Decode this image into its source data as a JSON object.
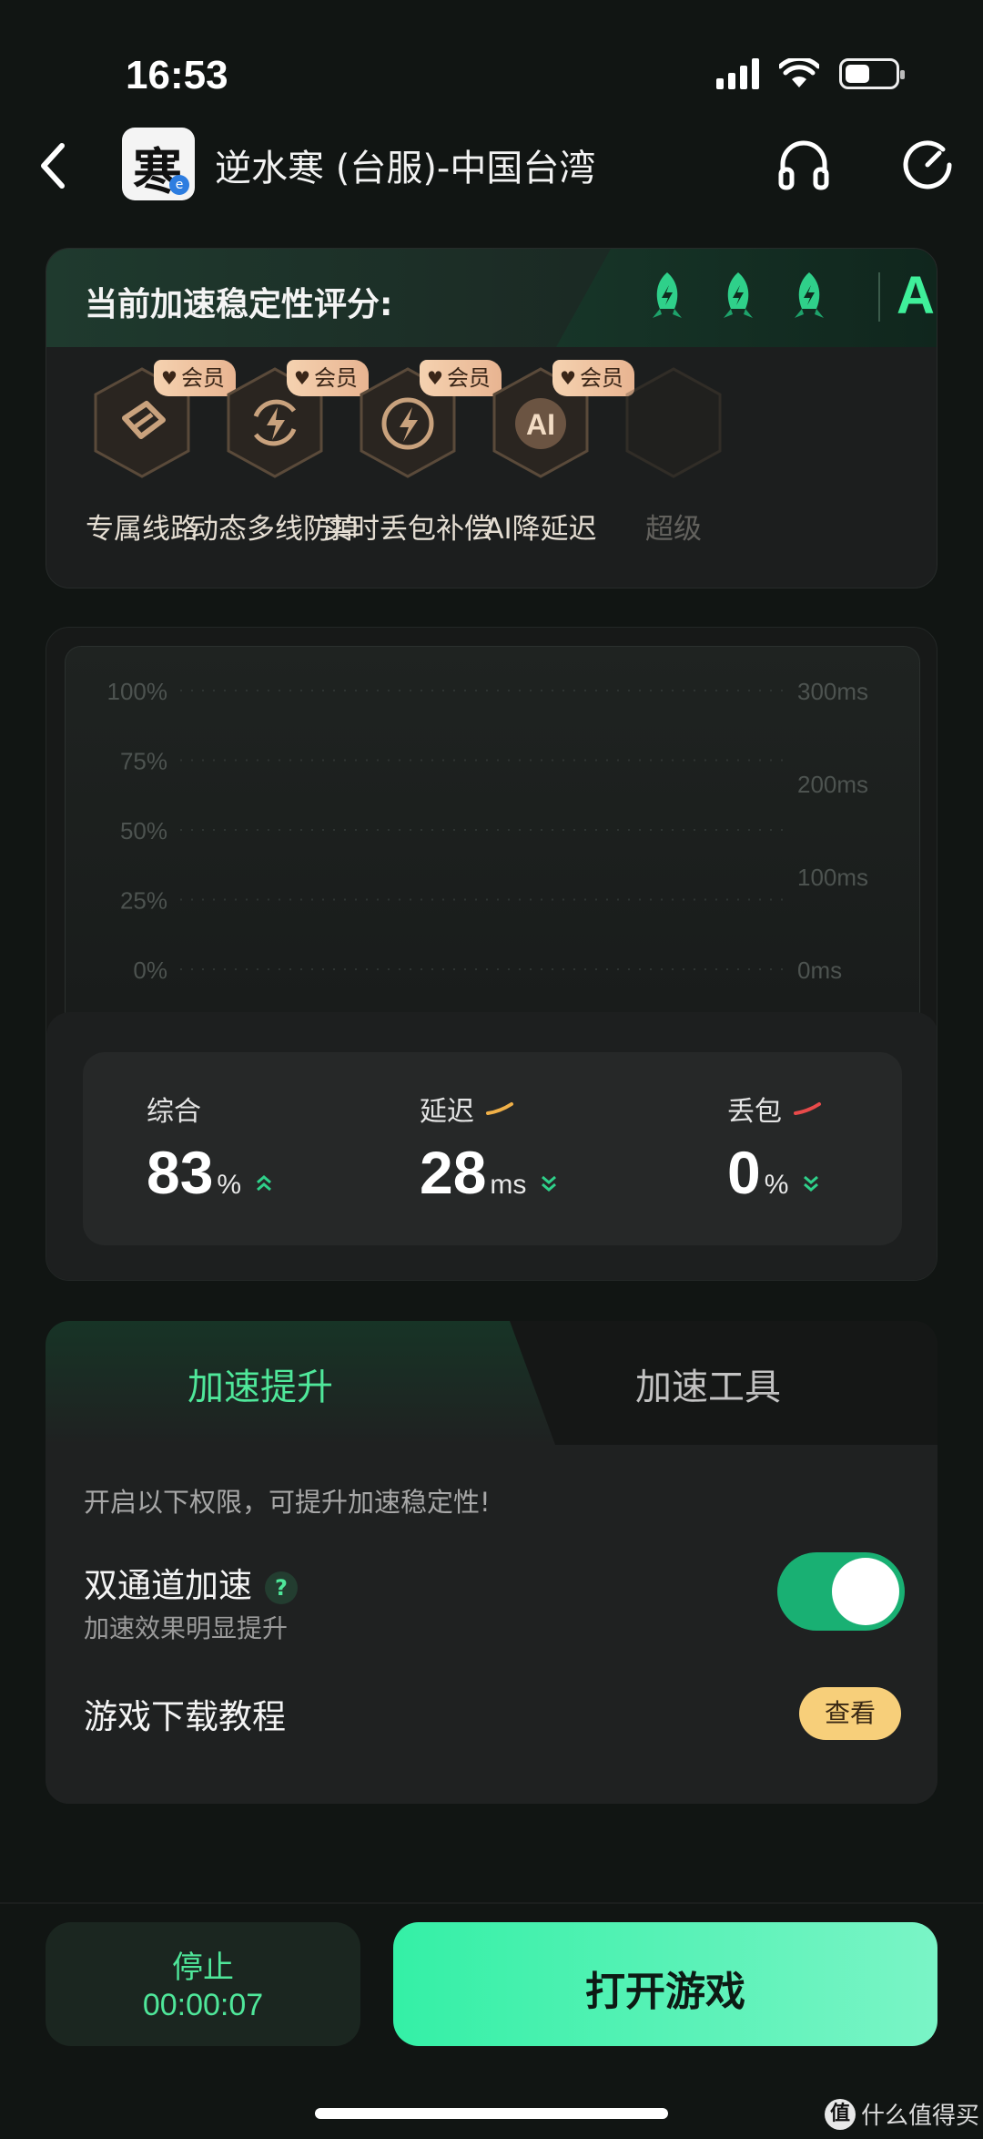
{
  "status_bar": {
    "time": "16:53"
  },
  "header": {
    "game_title": "逆水寒 (台服)-中国台湾",
    "game_icon_char": "寒"
  },
  "stability": {
    "title": "当前加速稳定性评分:",
    "grade": "A",
    "rocket_count": 3,
    "accent_color": "#3ff09a"
  },
  "features": [
    {
      "label": "专属线路",
      "badge": "会员"
    },
    {
      "label": "动态多线防掉",
      "badge": "会员"
    },
    {
      "label": "实时丢包补偿",
      "badge": "会员"
    },
    {
      "label": "AI降延迟",
      "badge": "会员"
    },
    {
      "label": "超级",
      "badge": ""
    }
  ],
  "chart_data": {
    "type": "line",
    "y_left_ticks": [
      "100%",
      "75%",
      "50%",
      "25%",
      "0%"
    ],
    "y_right_ticks": [
      "300ms",
      "200ms",
      "100ms",
      "0ms"
    ],
    "series": [
      {
        "name": "延迟",
        "color": "#f0b048",
        "values": []
      },
      {
        "name": "丢包",
        "color": "#e84a4a",
        "values": []
      }
    ],
    "grid": true
  },
  "stats": {
    "overall": {
      "label": "综合",
      "value": "83",
      "unit": "%"
    },
    "latency": {
      "label": "延迟",
      "value": "28",
      "unit": "ms",
      "legend_color": "#f0b048"
    },
    "loss": {
      "label": "丢包",
      "value": "0",
      "unit": "%",
      "legend_color": "#e84a4a"
    }
  },
  "tabs": {
    "active": "加速提升",
    "inactive": "加速工具"
  },
  "boost_panel": {
    "hint": "开启以下权限，可提升加速稳定性!",
    "dual_channel": {
      "title": "双通道加速",
      "help": "?",
      "subtitle": "加速效果明显提升",
      "enabled": true
    },
    "tutorial": {
      "title": "游戏下载教程",
      "button": "查看"
    }
  },
  "bottom": {
    "stop_label": "停止",
    "elapsed": "00:00:07",
    "open_game": "打开游戏"
  },
  "watermark": {
    "badge": "值",
    "text": "什么值得买"
  }
}
